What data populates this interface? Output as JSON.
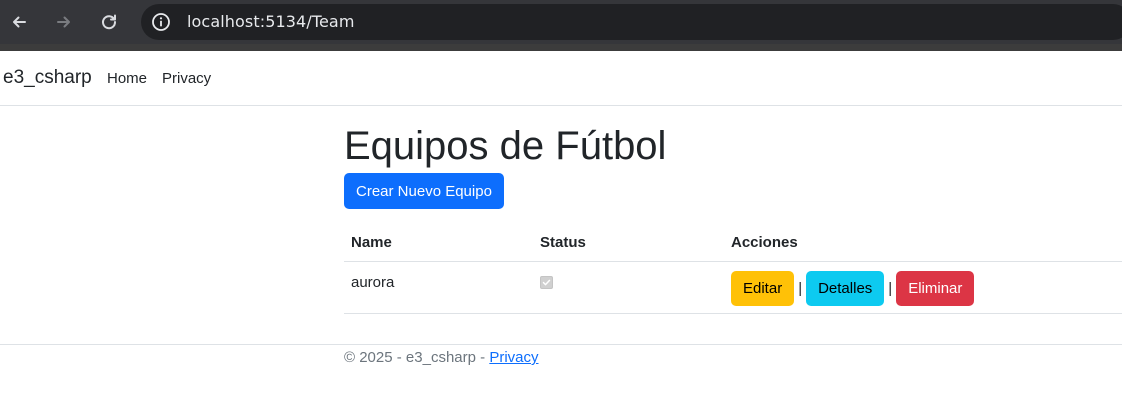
{
  "browser": {
    "url": "localhost:5134/Team"
  },
  "navbar": {
    "brand": "e3_csharp",
    "links": [
      "Home",
      "Privacy"
    ]
  },
  "main": {
    "title": "Equipos de Fútbol",
    "create_button": "Crear Nuevo Equipo",
    "table": {
      "headers": [
        "Name",
        "Status",
        "Acciones"
      ],
      "rows": [
        {
          "name": "aurora",
          "status_checked": true,
          "actions": [
            "Editar",
            "Detalles",
            "Eliminar"
          ]
        }
      ],
      "separator": "|"
    }
  },
  "footer": {
    "text": "© 2025 - e3_csharp - ",
    "link": "Privacy"
  },
  "colors": {
    "primary": "#0d6efd",
    "warning": "#ffc107",
    "info": "#0dcaf0",
    "danger": "#dc3545"
  }
}
